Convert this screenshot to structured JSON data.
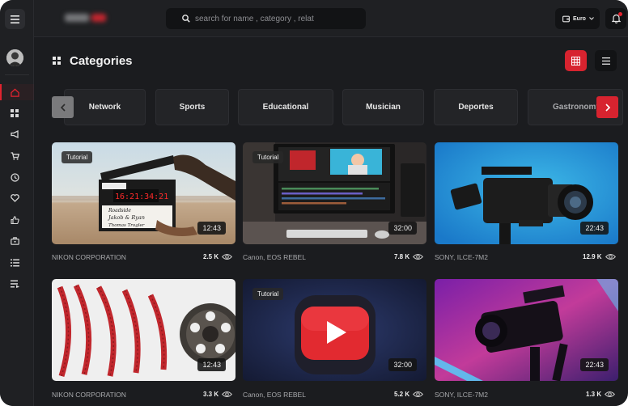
{
  "header": {
    "search_placeholder": "search for name , category , relat",
    "currency": "Euro"
  },
  "page": {
    "title": "Categories"
  },
  "categories": [
    "Network",
    "Sports",
    "Educational",
    "Musician",
    "Deportes",
    "Gastronomy"
  ],
  "cards": [
    {
      "tag": "Tutorial",
      "duration": "12:43",
      "name": "NIKON CORPORATION",
      "views": "2.5 K"
    },
    {
      "tag": "Tutorial",
      "duration": "32:00",
      "name": "Canon, EOS REBEL",
      "views": "7.8 K"
    },
    {
      "tag": "",
      "duration": "22:43",
      "name": "SONY, ILCE-7M2",
      "views": "12.9 K"
    },
    {
      "tag": "",
      "duration": "12:43",
      "name": "NIKON CORPORATION",
      "views": "3.3 K"
    },
    {
      "tag": "Tutorial",
      "duration": "32:00",
      "name": "Canon, EOS REBEL",
      "views": "5.2 K"
    },
    {
      "tag": "",
      "duration": "22:43",
      "name": "SONY, ILCE-7M2",
      "views": "1.3 K"
    }
  ],
  "slate": {
    "roll": "Roadside",
    "names": "Jakob & Ryan",
    "director": "Thomas Trogler",
    "timecode": "16:21:34:21"
  },
  "sidebar": {
    "icons": [
      "home-icon",
      "dashboard-icon",
      "megaphone-icon",
      "cart-icon",
      "clock-icon",
      "heart-icon",
      "thumbs-up-icon",
      "briefcase-icon",
      "list-icon",
      "playlist-icon"
    ]
  },
  "colors": {
    "accent": "#d7232f",
    "background": "#1b1c1f"
  }
}
